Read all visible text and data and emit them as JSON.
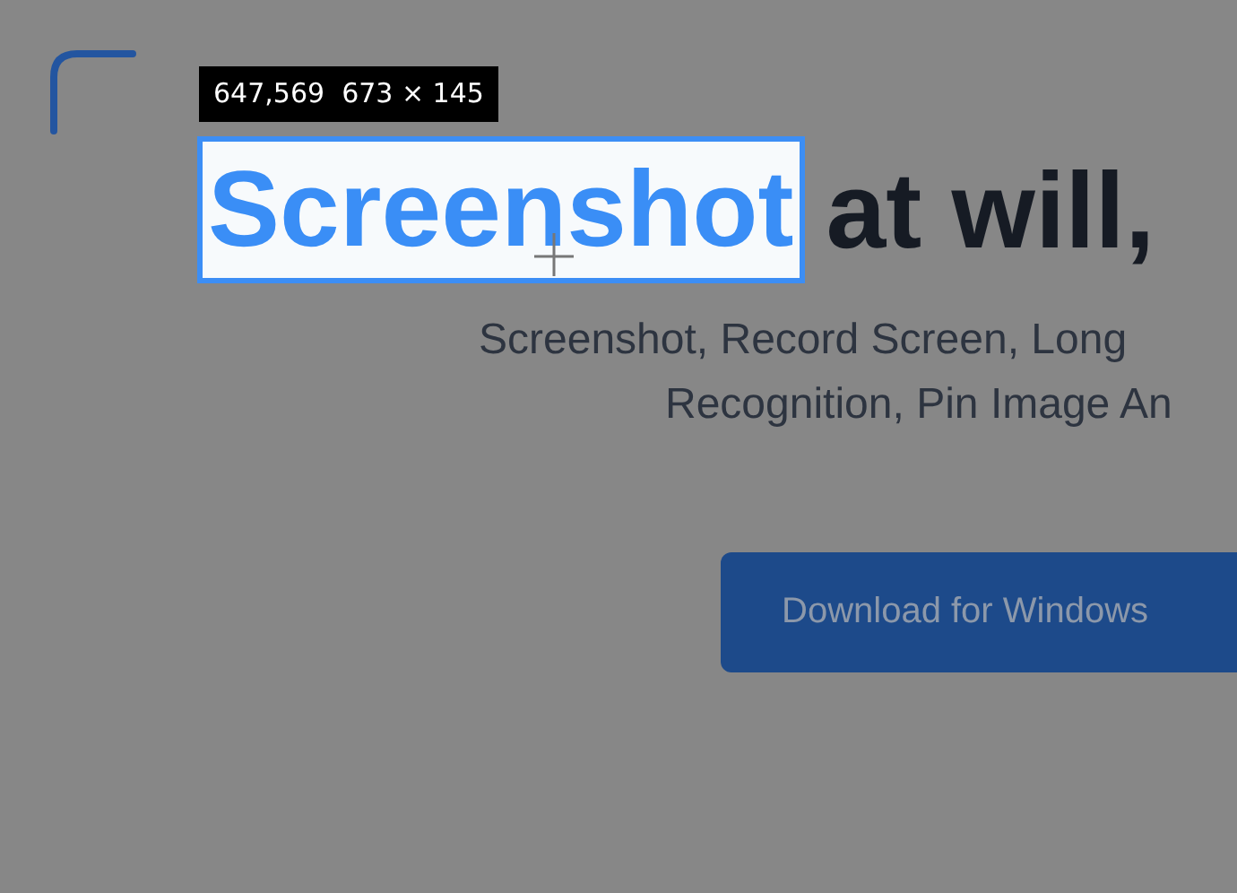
{
  "selection": {
    "info": "647,569  673 × 145"
  },
  "headline": {
    "selected": "Screenshot",
    "rest": "at will,"
  },
  "subtitle": [
    "Screenshot, Record Screen, Long",
    "Recognition, Pin Image An"
  ],
  "button": {
    "label": "Download for Windows"
  }
}
